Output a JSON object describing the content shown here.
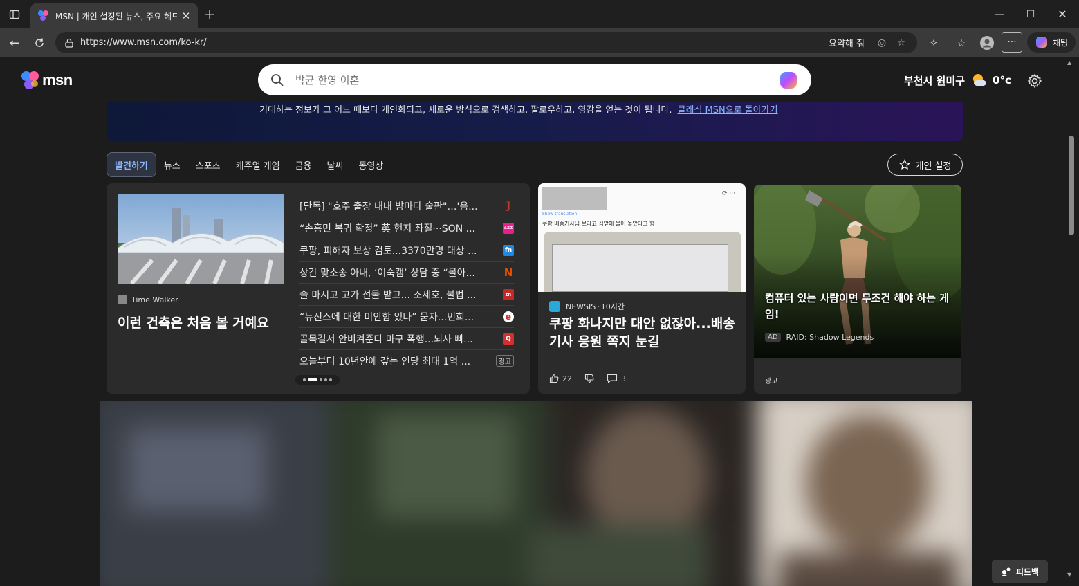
{
  "browser": {
    "tab_title": "MSN | 개인 설정된 뉴스, 주요 헤드",
    "url": "https://www.msn.com/ko-kr/",
    "summarize_label": "요약해 줘",
    "chat_label": "채팅"
  },
  "header": {
    "logo_text": "msn",
    "search_placeholder": "박균 한영 이혼",
    "location": "부천시 원미구",
    "temperature": "0°c"
  },
  "banner": {
    "text": "기대하는 정보가 그 어느 때보다 개인화되고, 새로운 방식으로 검색하고, 팔로우하고, 영감을 얻는 것이 됩니다.",
    "link": "클래식 MSN으로 돌아가기"
  },
  "categories": [
    "발견하기",
    "뉴스",
    "스포츠",
    "캐주얼 게임",
    "금융",
    "날씨",
    "동영상"
  ],
  "personalize_label": "개인 설정",
  "lead_story": {
    "source": "Time Walker",
    "title": "이런 건축은 처음 볼 거예요"
  },
  "headlines": [
    {
      "text": "[단독] \"호주 출장 내내 밤마다 술판\"…'음...",
      "badge": "J",
      "color": "#c0392b"
    },
    {
      "text": "“손흥민 복귀 확정” 英 현지 좌절···SON ...",
      "badge": "스포츠",
      "color": "#e91e8c"
    },
    {
      "text": "쿠팡, 피해자 보상 검토...3370만명 대상 ...",
      "badge": "fn",
      "color": "#1e88e5"
    },
    {
      "text": "상간 맞소송 아내, ‘이숙캠’ 상담 중 “몰아...",
      "badge": "N",
      "color": "#e65100"
    },
    {
      "text": "술 마시고 고가 선물 받고... 조세호, 불법 ...",
      "badge": "tn",
      "color": "#c62828"
    },
    {
      "text": "“뉴진스에 대한 미안함 있나” 묻자...민희...",
      "badge": "e",
      "color": "#d32f2f"
    },
    {
      "text": "골목길서 안비켜준다 마구 폭행...뇌사 빠...",
      "badge": "Q",
      "color": "#d32f2f"
    },
    {
      "text": "오늘부터 10년안에 갚는 인당 최대 1억 ...",
      "badge": "광고",
      "color": ""
    }
  ],
  "news_card": {
    "image_caption": "쿠팡 배송기사님 보라고 집앞에 올어 놓았다고 함",
    "image_translation": "Show translation",
    "source": "NEWSIS",
    "time": "10시간",
    "title": "쿠팡 화나지만 대안 없잖아...배송기사 응원 쪽지 눈길",
    "likes": "22",
    "comments": "3"
  },
  "ad_card": {
    "title": "컴퓨터 있는 사람이면 무조건 해야 하는 게임!",
    "ad_label": "AD",
    "advertiser": "RAID: Shadow Legends",
    "footer": "광고"
  },
  "feedback_label": "피드백"
}
